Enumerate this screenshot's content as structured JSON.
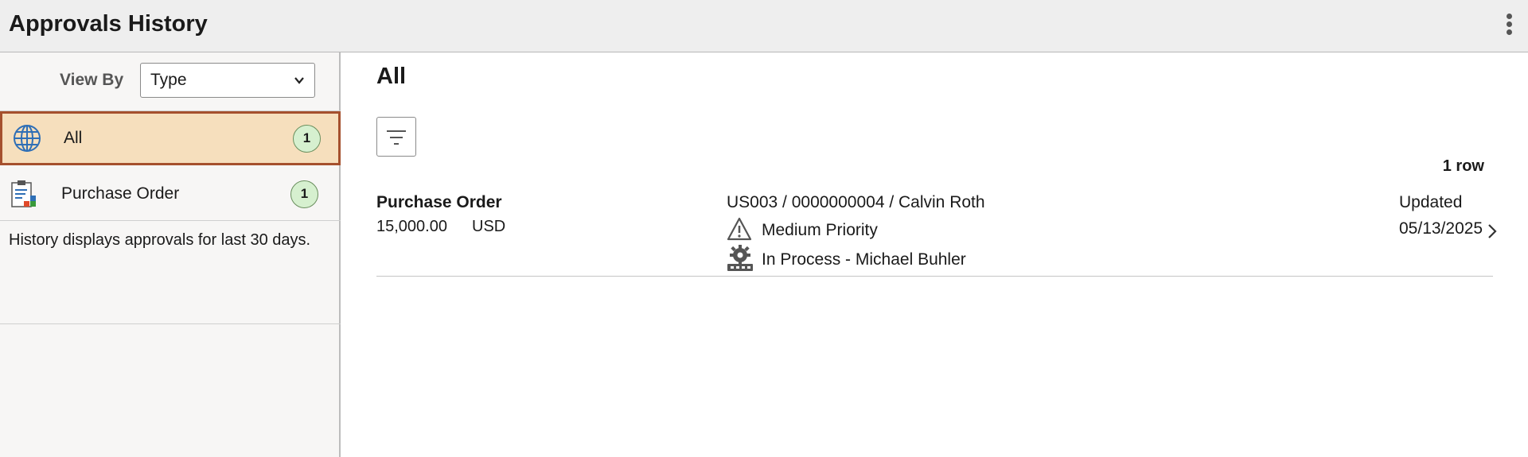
{
  "header": {
    "title": "Approvals History",
    "more_icon": "vertical-ellipsis-icon"
  },
  "sidebar": {
    "view_by_label": "View By",
    "view_by_value": "Type",
    "items": [
      {
        "label": "All",
        "count": "1",
        "icon": "globe-icon",
        "selected": true
      },
      {
        "label": "Purchase Order",
        "count": "1",
        "icon": "clipboard-document-icon",
        "selected": false
      }
    ],
    "note": "History displays approvals for last 30 days."
  },
  "main": {
    "title": "All",
    "filter_icon": "filter-icon",
    "row_count": "1 row",
    "rows": [
      {
        "type": "Purchase Order",
        "amount": "15,000.00",
        "currency": "USD",
        "reference": "US003 / 0000000004 / Calvin Roth",
        "priority": "Medium Priority",
        "status": "In Process - Michael Buhler",
        "updated_label": "Updated",
        "updated_date": "05/13/2025"
      }
    ]
  },
  "colors": {
    "header_bg": "#eeeeee",
    "sidebar_bg": "#f7f6f5",
    "selected_bg": "#f6dfbd",
    "selected_border": "#a5502d",
    "badge_bg": "#d6f0cf"
  }
}
